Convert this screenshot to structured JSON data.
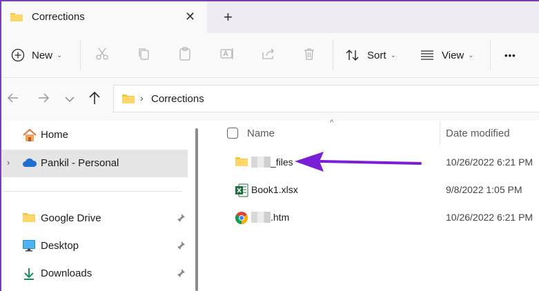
{
  "window": {
    "tab_title": "Corrections",
    "close_glyph": "✕",
    "new_tab_glyph": "+"
  },
  "toolbar": {
    "new_label": "New",
    "sort_label": "Sort",
    "view_label": "View",
    "more_glyph": "•••",
    "icons": [
      "add-icon",
      "cut-icon",
      "copy-icon",
      "paste-icon",
      "rename-icon",
      "share-icon",
      "delete-icon",
      "sort-icon",
      "view-icon"
    ]
  },
  "address_bar": {
    "crumbs": [
      "Corrections"
    ]
  },
  "sidebar": {
    "items": [
      {
        "label": "Home",
        "icon": "home-icon"
      },
      {
        "label": "Pankil - Personal",
        "icon": "onedrive-cloud-icon",
        "selected": true
      },
      {
        "label": "Google Drive",
        "icon": "folder-icon",
        "pinned": true
      },
      {
        "label": "Desktop",
        "icon": "desktop-icon",
        "pinned": true
      },
      {
        "label": "Downloads",
        "icon": "download-icon",
        "pinned": true
      }
    ]
  },
  "file_list": {
    "columns": [
      "Name",
      "Date modified"
    ],
    "rows": [
      {
        "name_suffix": "_files",
        "date": "10/26/2022 6:21 PM",
        "icon": "folder-icon"
      },
      {
        "name": "Book1.xlsx",
        "date": "9/8/2022 1:05 PM",
        "icon": "excel-file-icon"
      },
      {
        "name_suffix": ".htm",
        "date": "10/26/2022 6:21 PM",
        "icon": "chrome-file-icon"
      }
    ]
  },
  "colors": {
    "accent_arrow": "#7b1fd6",
    "folder_yellow": "#f4c542",
    "selected_bg": "#e5e5e5"
  }
}
